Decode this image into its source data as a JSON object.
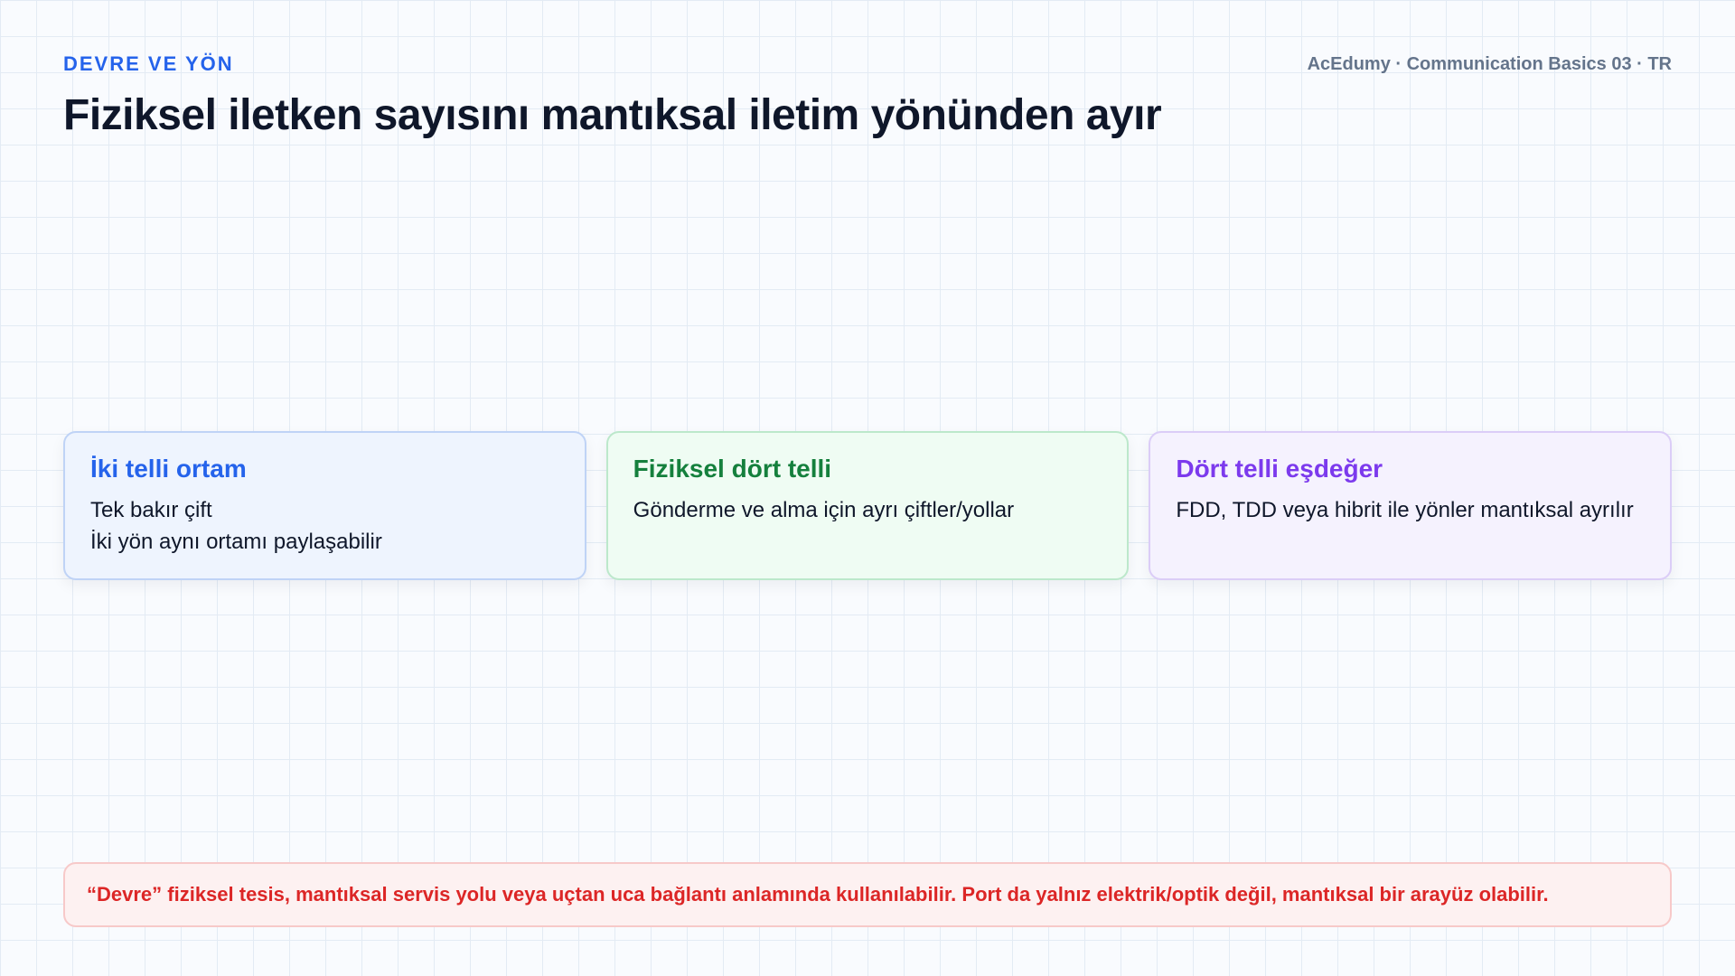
{
  "header": {
    "kicker": "DEVRE VE YÖN",
    "brand": "AcEdumy · Communication Basics 03 · TR",
    "title": "Fiziksel iletken sayısını mantıksal iletim yönünden ayır"
  },
  "cards": [
    {
      "title": "İki telli ortam",
      "lines": [
        "Tek bakır çift",
        "İki yön aynı ortamı paylaşabilir"
      ],
      "accent": "#2563eb"
    },
    {
      "title": "Fiziksel dört telli",
      "lines": [
        "Gönderme ve alma için ayrı çiftler/yollar"
      ],
      "accent": "#15803d"
    },
    {
      "title": "Dört telli eşdeğer",
      "lines": [
        "FDD, TDD veya hibrit ile yönler mantıksal ayrılır"
      ],
      "accent": "#7c3aed"
    }
  ],
  "note": {
    "text": "“Devre” fiziksel tesis, mantıksal servis yolu veya uçtan uca bağlantı anlamında kullanılabilir. Port da yalnız elektrik/optik değil, mantıksal bir arayüz olabilir.",
    "color": "#dc2626"
  }
}
